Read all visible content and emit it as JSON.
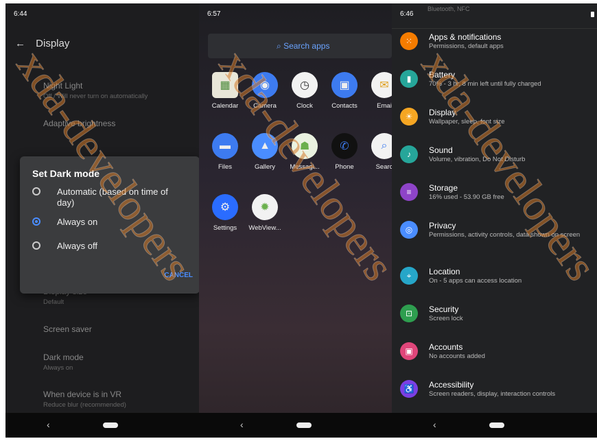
{
  "panel1": {
    "status_time": "6:44",
    "title": "Display",
    "items": [
      {
        "title": "Night Light",
        "subtitle": "Off / Will never turn on automatically"
      },
      {
        "title": "Adaptive brightness",
        "subtitle": ""
      },
      {
        "title": "Display size",
        "subtitle": "Default"
      },
      {
        "title": "Screen saver",
        "subtitle": ""
      },
      {
        "title": "Dark mode",
        "subtitle": "Always on"
      },
      {
        "title": "When device is in VR",
        "subtitle": "Reduce blur (recommended)"
      }
    ],
    "dialog": {
      "title": "Set Dark mode",
      "options": [
        {
          "label": "Automatic (based on time of day)",
          "selected": false
        },
        {
          "label": "Always on",
          "selected": true
        },
        {
          "label": "Always off",
          "selected": false
        }
      ],
      "cancel": "CANCEL"
    }
  },
  "panel2": {
    "status_time": "6:57",
    "search_label": "Search apps",
    "apps": [
      {
        "label": "Calendar",
        "icon": "calendar-icon",
        "color": "#e8e6d8"
      },
      {
        "label": "Camera",
        "icon": "camera-icon",
        "color": "#3d7bf0"
      },
      {
        "label": "Clock",
        "icon": "clock-icon",
        "color": "#f2f2f2"
      },
      {
        "label": "Contacts",
        "icon": "contacts-icon",
        "color": "#3d7bf0"
      },
      {
        "label": "Emai",
        "icon": "email-icon",
        "color": "#f2f2f2"
      },
      {
        "label": "Files",
        "icon": "folder-icon",
        "color": "#3d7bf0"
      },
      {
        "label": "Gallery",
        "icon": "gallery-icon",
        "color": "#4a8dff"
      },
      {
        "label": "Messagi...",
        "icon": "messaging-icon",
        "color": "#eaf2e0"
      },
      {
        "label": "Phone",
        "icon": "phone-icon",
        "color": "#111111"
      },
      {
        "label": "Searc",
        "icon": "search-icon",
        "color": "#f2f2f2"
      },
      {
        "label": "Settings",
        "icon": "gear-icon",
        "color": "#2a6cff"
      },
      {
        "label": "WebView...",
        "icon": "android-icon",
        "color": "#f2f2f2"
      }
    ]
  },
  "panel3": {
    "status_time": "6:46",
    "top_partial": "Bluetooth, NFC",
    "items": [
      {
        "title": "Apps & notifications",
        "subtitle": "Permissions, default apps",
        "icon": "apps-icon",
        "color": "#f57c00"
      },
      {
        "title": "Battery",
        "subtitle": "70% - 3 hr, 8 min left until fully charged",
        "icon": "battery-icon",
        "color": "#26a69a"
      },
      {
        "title": "Display",
        "subtitle": "Wallpaper, sleep, font size",
        "icon": "display-icon",
        "color": "#f5a623"
      },
      {
        "title": "Sound",
        "subtitle": "Volume, vibration, Do Not Disturb",
        "icon": "sound-icon",
        "color": "#26a69a"
      },
      {
        "title": "Storage",
        "subtitle": "16% used - 53.90 GB free",
        "icon": "storage-icon",
        "color": "#8e44c8"
      },
      {
        "title": "Privacy",
        "subtitle": "Permissions, activity controls, data shown on screen",
        "icon": "privacy-icon",
        "color": "#4a8dff"
      },
      {
        "title": "Location",
        "subtitle": "On - 5 apps can access location",
        "icon": "location-icon",
        "color": "#26a6c8"
      },
      {
        "title": "Security",
        "subtitle": "Screen lock",
        "icon": "lock-icon",
        "color": "#2e9e4f"
      },
      {
        "title": "Accounts",
        "subtitle": "No accounts added",
        "icon": "accounts-icon",
        "color": "#e0467a"
      },
      {
        "title": "Accessibility",
        "subtitle": "Screen readers, display, interaction controls",
        "icon": "accessibility-icon",
        "color": "#7b3fe4"
      }
    ]
  },
  "watermark": "xda-developers",
  "navbar": {
    "back_glyph": "‹"
  }
}
